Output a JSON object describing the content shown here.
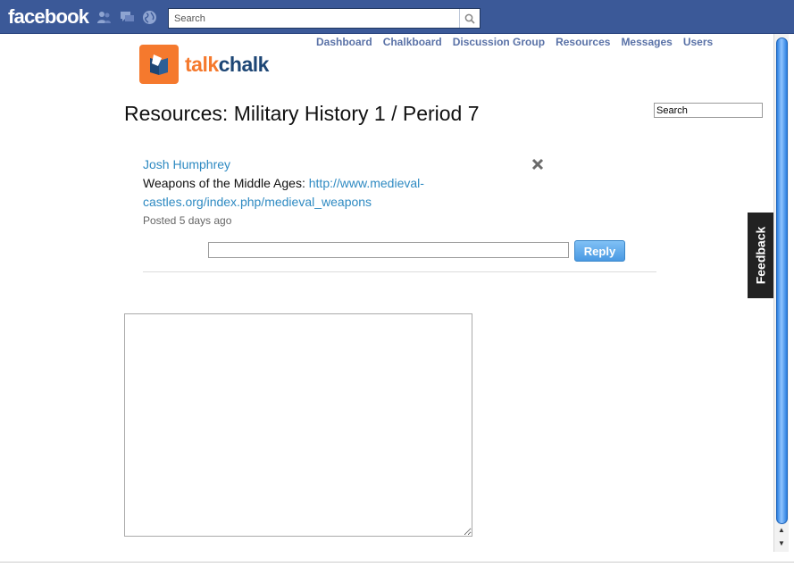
{
  "facebook": {
    "logo": "facebook",
    "search_placeholder": "Search"
  },
  "app": {
    "brand_part1": "talk",
    "brand_part2": "chalk",
    "nav": [
      {
        "label": "Dashboard"
      },
      {
        "label": "Chalkboard"
      },
      {
        "label": "Discussion Group"
      },
      {
        "label": "Resources"
      },
      {
        "label": "Messages"
      },
      {
        "label": "Users"
      }
    ],
    "page_title": "Resources: Military History 1 / Period 7",
    "search_value": "Search",
    "post": {
      "author": "Josh Humphrey",
      "text": "Weapons of the Middle Ages: ",
      "link": "http://www.medieval-castles.org/index.php/medieval_weapons",
      "time": "Posted 5 days ago"
    },
    "reply_button": "Reply",
    "feedback_label": "Feedback"
  },
  "colors": {
    "facebook_blue": "#3b5998",
    "nav_link": "#5a72a7",
    "link_blue": "#2e8ac2",
    "brand_orange": "#f5792d",
    "brand_navy": "#1d4675"
  },
  "icons": [
    "friends-icon",
    "messages-icon",
    "notifications-globe-icon",
    "search-icon",
    "book-logo-icon",
    "close-icon",
    "scroll-up-icon",
    "scroll-down-icon"
  ]
}
